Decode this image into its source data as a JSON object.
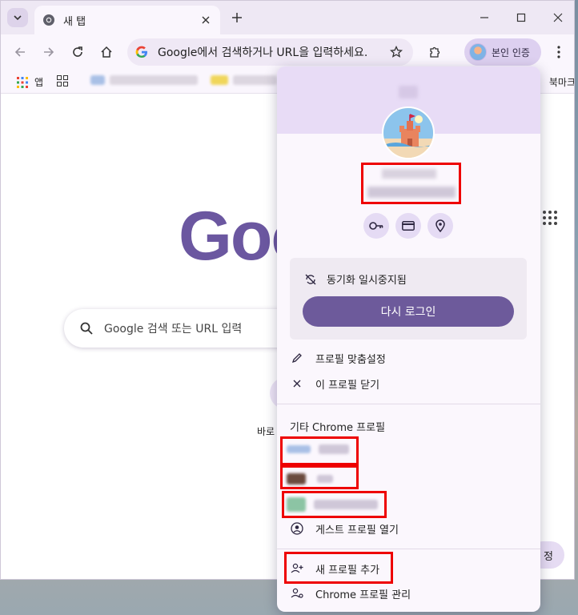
{
  "tab": {
    "title": "새 탭"
  },
  "omnibox": {
    "placeholder": "Google에서 검색하거나 URL을 입력하세요."
  },
  "profile_chip": {
    "label": "본인 인증"
  },
  "bookmarks": {
    "apps_label": "앱",
    "bookmarks_label": "북마크"
  },
  "ntp": {
    "logo": "Goo",
    "search_placeholder": "Google 검색 또는 URL 입력",
    "shortcut_label": "바로",
    "customize_label": "정"
  },
  "profile_menu": {
    "sync_status": "동기화 일시중지됨",
    "signin_button": "다시 로그인",
    "customize_profile": "프로필 맞춤설정",
    "close_profile": "이 프로필 닫기",
    "other_profiles_title": "기타 Chrome 프로필",
    "guest_profile": "게스트 프로필 열기",
    "add_profile": "새 프로필 추가",
    "manage_profiles": "Chrome 프로필 관리"
  },
  "colors": {
    "accent": "#6d5a9b",
    "tabstrip": "#eee8f4",
    "highlight": "#e00000"
  }
}
